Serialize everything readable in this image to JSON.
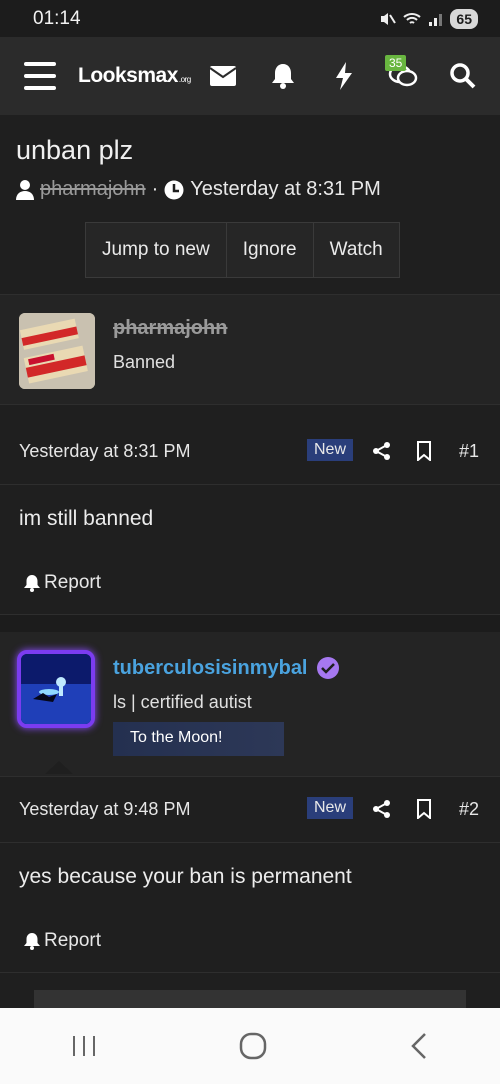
{
  "status": {
    "time": "01:14",
    "battery": "65"
  },
  "nav": {
    "logo_main": "Looksmax",
    "logo_sub": ".org",
    "messages_badge": "35"
  },
  "thread": {
    "title": "unban plz",
    "author": "pharmajohn",
    "separator": "·",
    "date": "Yesterday at 8:31 PM",
    "buttons": [
      "Jump to new",
      "Ignore",
      "Watch"
    ]
  },
  "posts": [
    {
      "username": "pharmajohn",
      "user_title": "Banned",
      "date": "Yesterday at 8:31 PM",
      "new_label": "New",
      "number": "#1",
      "body": "im still banned",
      "report": "Report"
    },
    {
      "username": "tuberculosisinmybal",
      "user_title": "ls | certified autist",
      "banner": "To the Moon!",
      "date": "Yesterday at 9:48 PM",
      "new_label": "New",
      "number": "#2",
      "body": "yes because your ban is permanent",
      "report": "Report"
    }
  ],
  "colors": {
    "accent": "#2a3e7a",
    "username2": "#4aa3df",
    "verified": "#a678f0",
    "badge_green": "#69b640"
  }
}
